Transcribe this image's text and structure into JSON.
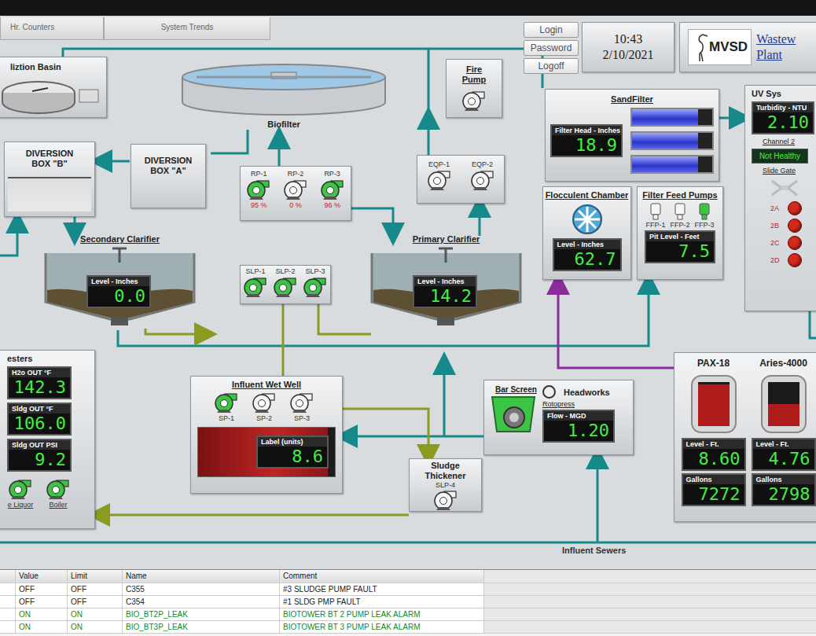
{
  "tabs": [
    {
      "label": "Hr. Counters",
      "selected": false
    },
    {
      "label": "System Trends",
      "selected": false
    }
  ],
  "session_buttons": [
    "Login",
    "Password",
    "Logoff"
  ],
  "clock": {
    "time": "10:43",
    "date": "2/10/2021"
  },
  "logo": {
    "text": "MVSD",
    "title_lines": [
      "Wastew",
      "Plant"
    ]
  },
  "equalization_basin": {
    "title": "liztion Basin"
  },
  "biofilter": {
    "title": "Biofilter"
  },
  "diversion_b": {
    "title_lines": [
      "DIVERSION",
      "BOX \"B\""
    ]
  },
  "diversion_a": {
    "title_lines": [
      "DIVERSION",
      "BOX \"A\""
    ]
  },
  "recirc_pumps": [
    {
      "label": "RP-1",
      "on": true,
      "reading": "95 %"
    },
    {
      "label": "RP-2",
      "on": false,
      "reading": "0 %"
    },
    {
      "label": "RP-3",
      "on": true,
      "reading": "96 %"
    }
  ],
  "fire_pump": {
    "title_lines": [
      "Fire",
      "Pump"
    ],
    "on": false
  },
  "eq_pumps": [
    {
      "label": "EQP-1",
      "on": false
    },
    {
      "label": "EQP-2",
      "on": false
    }
  ],
  "secondary_clarifier": {
    "title": "Secondary Clarifier",
    "readout_label": "Level - Inches",
    "value": "0.0"
  },
  "sludge_pumps": [
    {
      "label": "SLP-1",
      "on": true
    },
    {
      "label": "SLP-2",
      "on": true
    },
    {
      "label": "SLP-3",
      "on": true
    }
  ],
  "primary_clarifier": {
    "title": "Primary Clarifier",
    "readout_label": "Level - Inches",
    "value": "14.2"
  },
  "sand_filter": {
    "title": "SandFilter",
    "readout_label": "Filter Head - Inches",
    "value": "18.9",
    "cells": [
      {
        "level": 0.82
      },
      {
        "level": 0.82
      },
      {
        "level": 0.82
      }
    ]
  },
  "uv_system": {
    "title": "UV Sys",
    "readout_label": "Turbidity - NTU",
    "value": "2.10",
    "channel": "Channel 2",
    "health": "Not Healthy",
    "healthy": false,
    "slide_gate": "Slide Gate",
    "gates": [
      {
        "label": "2A",
        "color": "#d42a1e"
      },
      {
        "label": "2B",
        "color": "#d42a1e"
      },
      {
        "label": "2C",
        "color": "#d42a1e"
      },
      {
        "label": "2D",
        "color": "#d42a1e"
      }
    ]
  },
  "flocculent_chamber": {
    "title": "Flocculent Chamber",
    "readout_label": "Level - Inches",
    "value": "62.7"
  },
  "filter_feed": {
    "title": "Filter Feed Pumps",
    "pumps": [
      {
        "label": "FFP-1",
        "on": false
      },
      {
        "label": "FFP-2",
        "on": false
      },
      {
        "label": "FFP-3",
        "on": true
      }
    ],
    "readout_label": "Pit Level - Feet",
    "value": "7.5"
  },
  "digesters": {
    "title": "esters",
    "readouts": [
      {
        "label": "H2o OUT °F",
        "value": "142.3"
      },
      {
        "label": "Sldg OUT °F",
        "value": "106.0"
      },
      {
        "label": "Sldg OUT PSI",
        "value": "9.2"
      }
    ],
    "pumps": [
      {
        "label": "e Liquor",
        "on": true
      },
      {
        "label": "Boiler",
        "on": true
      }
    ]
  },
  "influent_wet_well": {
    "title": "Influent Wet Well",
    "pumps": [
      {
        "label": "SP-1",
        "on": true
      },
      {
        "label": "SP-2",
        "on": false
      },
      {
        "label": "SP-3",
        "on": false
      }
    ],
    "readout_label": "Label (units)",
    "value": "8.6",
    "level": 0.95
  },
  "sludge_thickener": {
    "title_lines": [
      "Sludge",
      "Thickener"
    ],
    "pump": {
      "label": "SLP-4",
      "on": false
    }
  },
  "headworks": {
    "title": "Headworks",
    "bar_screen": {
      "label": "Bar Screen",
      "on": true
    },
    "rotopress": {
      "label": "Rotopress",
      "on": false
    },
    "readout_label": "Flow - MGD",
    "value": "1.20"
  },
  "chemical_tanks": [
    {
      "name": "PAX-18",
      "level": 0.95,
      "level_label": "Level - Ft.",
      "level_value": "8.60",
      "gallons_label": "Gallons",
      "gallons_value": "7272"
    },
    {
      "name": "Aries-4000",
      "level": 0.5,
      "level_label": "Level - Ft.",
      "level_value": "4.76",
      "gallons_label": "Gallons",
      "gallons_value": "2798"
    }
  ],
  "influent_sewers": {
    "label": "Influent Sewers"
  },
  "alarm_table": {
    "columns": [
      "Value",
      "Limit",
      "Name",
      "Comment"
    ],
    "rows": [
      {
        "value": "OFF",
        "limit": "OFF",
        "name": "C355",
        "comment": "#3 SLUDGE PUMP FAULT",
        "color": "#222222"
      },
      {
        "value": "OFF",
        "limit": "OFF",
        "name": "C354",
        "comment": "#1 SLDG PMP FAULT",
        "color": "#222222"
      },
      {
        "value": "ON",
        "limit": "ON",
        "name": "BIO_BT2P_LEAK",
        "comment": "BIOTOWER BT 2 PUMP LEAK ALARM",
        "color": "#128a1e"
      },
      {
        "value": "ON",
        "limit": "ON",
        "name": "BIO_BT3P_LEAK",
        "comment": "BIOTOWER BT 3 PUMP LEAK ALARM",
        "color": "#128a1e"
      }
    ]
  }
}
